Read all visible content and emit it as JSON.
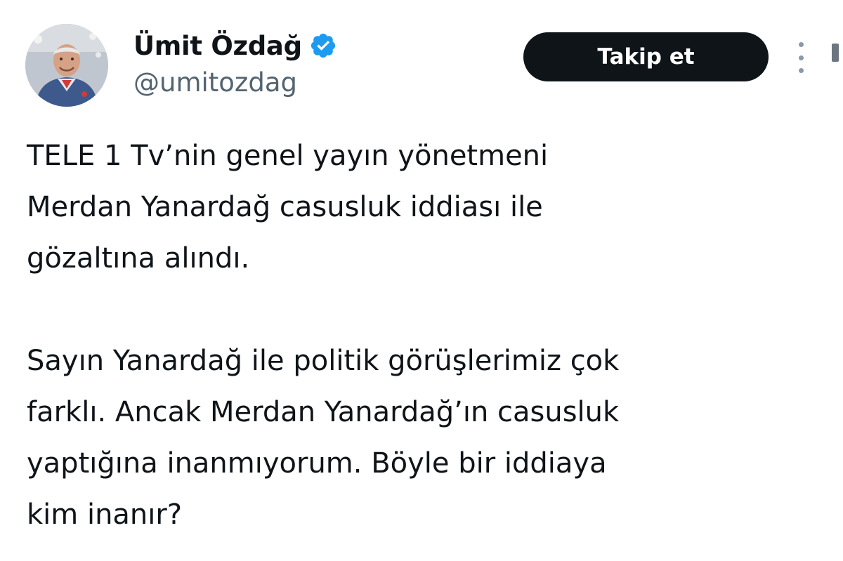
{
  "author": {
    "display_name": "Ümit Özdağ",
    "handle": "@umitozdag",
    "verified_icon": "verified-badge-icon",
    "accent_color": "#1d9bf0"
  },
  "actions": {
    "follow_label": "Takip et",
    "more_icon": "more-options-icon"
  },
  "tweet": {
    "lines": [
      "TELE 1 Tv’nin genel yayın yönetmeni",
      "Merdan Yanardağ casusluk iddiası ile",
      "gözaltına alındı.",
      "",
      "Sayın Yanardağ ile politik görüşlerimiz çok",
      "farklı. Ancak Merdan Yanardağ’ın casusluk",
      "yaptığına inanmıyorum. Böyle bir iddiaya",
      "kim inanır?"
    ]
  }
}
